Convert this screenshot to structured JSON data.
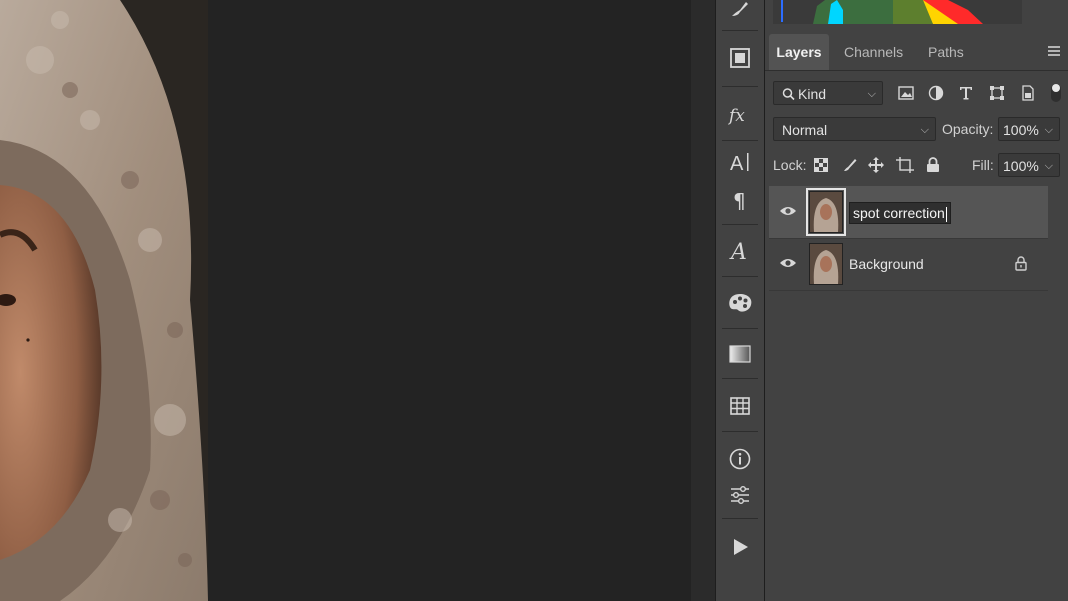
{
  "panel": {
    "tabs": [
      {
        "label": "Layers",
        "active": true
      },
      {
        "label": "Channels",
        "active": false
      },
      {
        "label": "Paths",
        "active": false
      }
    ],
    "filter": {
      "label": "Kind"
    },
    "blend_mode": {
      "value": "Normal"
    },
    "opacity": {
      "label": "Opacity:",
      "value": "100%"
    },
    "lock": {
      "label": "Lock:"
    },
    "fill": {
      "label": "Fill:",
      "value": "100%"
    },
    "layers": [
      {
        "name": "spot correction",
        "selected": true,
        "editing": true,
        "locked": false
      },
      {
        "name": "Background",
        "selected": false,
        "editing": false,
        "locked": true
      }
    ]
  },
  "toolbar_icons": [
    "brush-settings-icon",
    "panel-icon",
    "fx-icon",
    "character-icon",
    "paragraph-icon",
    "glyphs-icon",
    "swatches-icon",
    "gradient-icon",
    "table-icon",
    "info-icon",
    "adjustments-icon",
    "play-icon"
  ],
  "colors": {
    "panel_bg": "#424242",
    "canvas_bg": "#232323",
    "selected_layer": "#555555"
  }
}
